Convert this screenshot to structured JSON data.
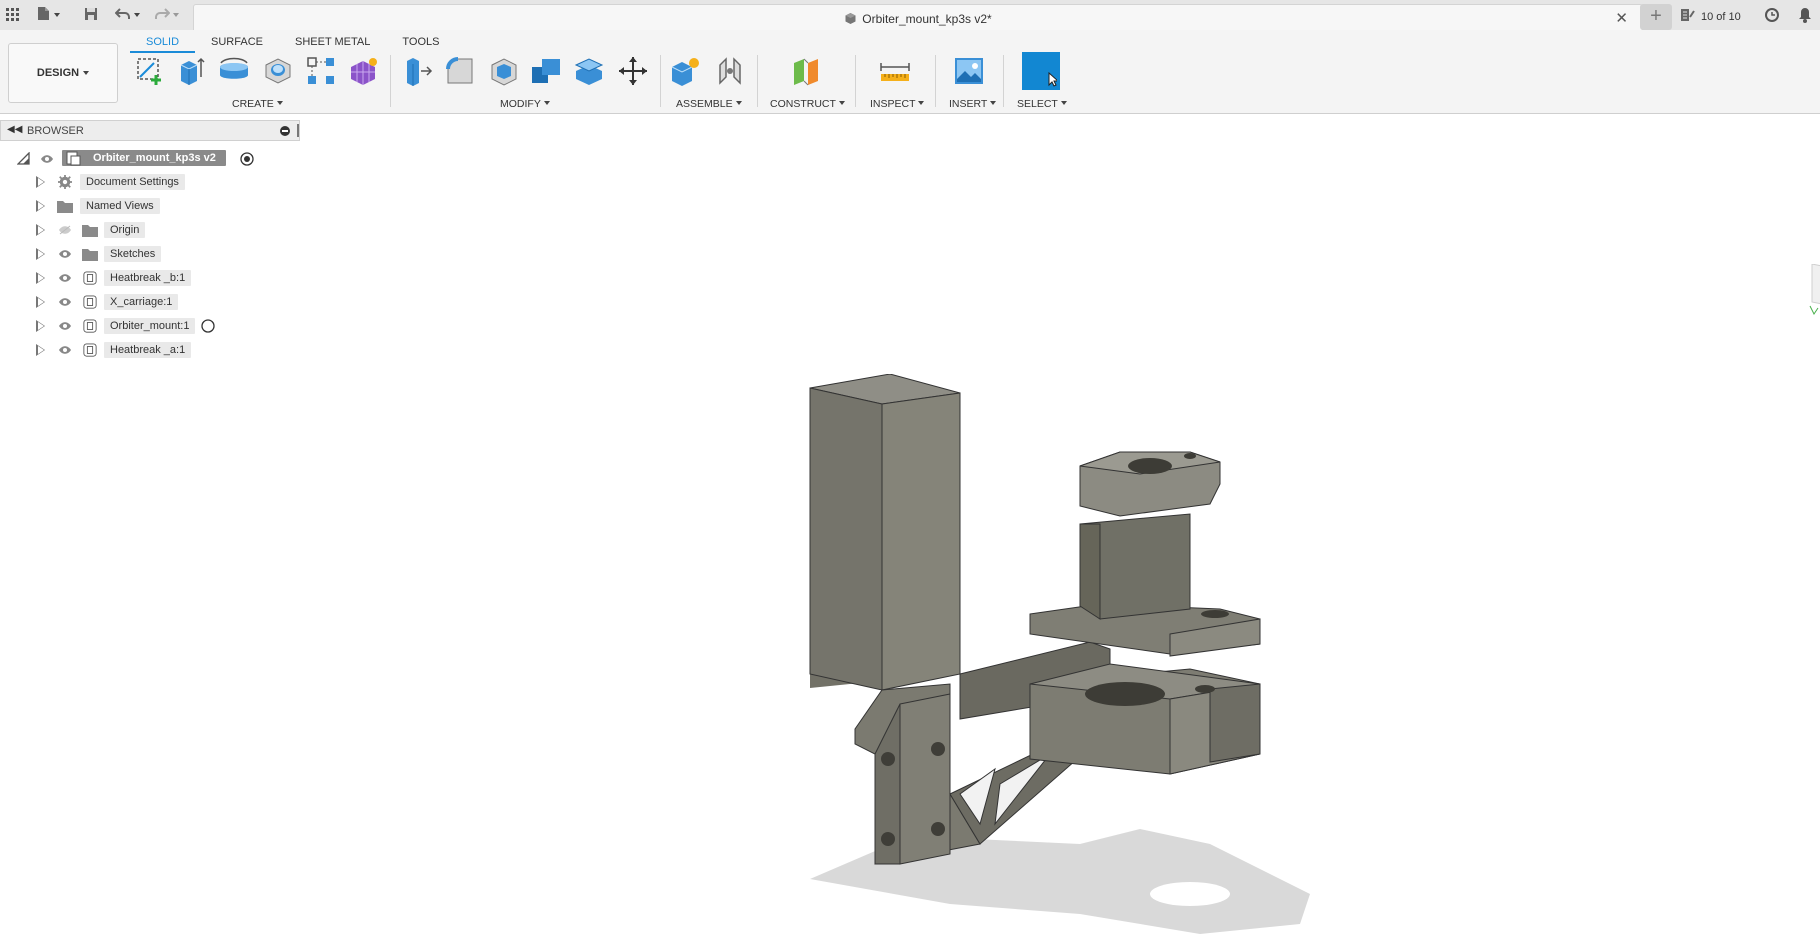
{
  "appbar": {
    "document_title": "Orbiter_mount_kp3s v2*",
    "versions_label": "10 of 10",
    "icons": [
      "apps-grid-icon",
      "file-icon",
      "save-icon",
      "undo-icon",
      "redo-icon",
      "close-icon",
      "plus-icon",
      "job-status-icon",
      "clock-icon",
      "bell-icon"
    ]
  },
  "ribbon": {
    "workspace_label": "DESIGN",
    "tabs": [
      {
        "label": "SOLID",
        "active": true
      },
      {
        "label": "SURFACE",
        "active": false
      },
      {
        "label": "SHEET METAL",
        "active": false
      },
      {
        "label": "TOOLS",
        "active": false
      }
    ],
    "groups": {
      "create": "CREATE",
      "modify": "MODIFY",
      "assemble": "ASSEMBLE",
      "construct": "CONSTRUCT",
      "inspect": "INSPECT",
      "insert": "INSERT",
      "select": "SELECT"
    },
    "accent_color": "#1a8bd8"
  },
  "browser": {
    "header": "BROWSER",
    "root": "Orbiter_mount_kp3s v2",
    "items": [
      {
        "label": "Document Settings",
        "icon": "gear-icon"
      },
      {
        "label": "Named Views",
        "icon": "folder-icon"
      },
      {
        "label": "Origin",
        "icon": "folder-icon",
        "hidden": true
      },
      {
        "label": "Sketches",
        "icon": "folder-icon"
      },
      {
        "label": "Heatbreak _b:1",
        "icon": "component-icon"
      },
      {
        "label": "X_carriage:1",
        "icon": "component-icon"
      },
      {
        "label": "Orbiter_mount:1",
        "icon": "component-icon",
        "active_radio": true
      },
      {
        "label": "Heatbreak _a:1",
        "icon": "component-icon"
      }
    ]
  }
}
